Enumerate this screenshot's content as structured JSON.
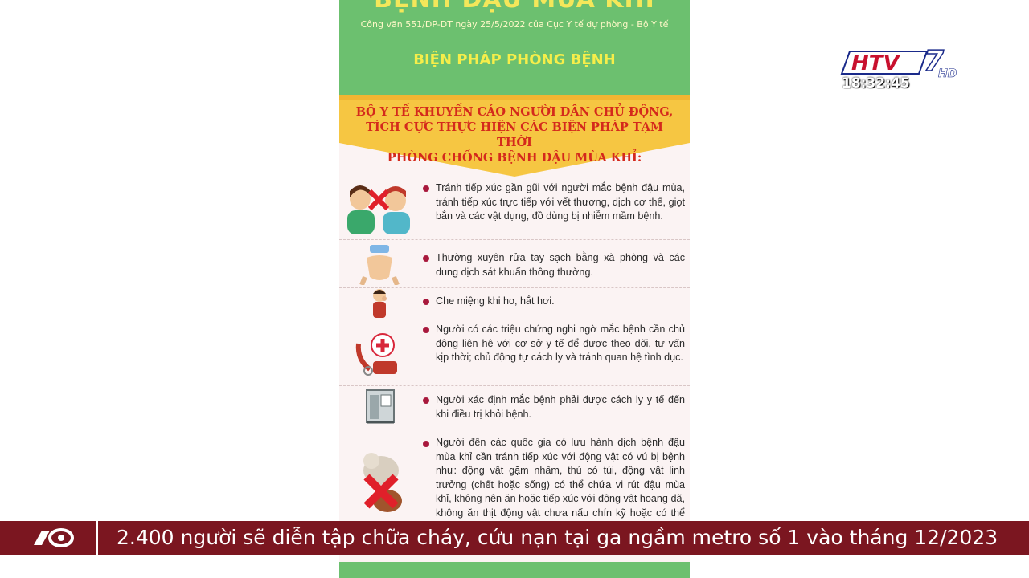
{
  "poster": {
    "title": "BỆNH ĐẬU MÙA KHỈ",
    "reference": "Công văn 551/DP-DT  ngày 25/5/2022 của Cục Y tế dự phòng - Bộ Y tế",
    "section_title": "BIỆN PHÁP PHÒNG BỆNH",
    "banner_lines": [
      "BỘ Y TẾ KHUYẾN CÁO NGƯỜI DÂN CHỦ ĐỘNG,",
      "TÍCH CỰC THỰC HIỆN CÁC BIỆN PHÁP TẠM THỜI",
      "PHÒNG CHỐNG BỆNH ĐẬU MÙA KHỈ:"
    ],
    "items": [
      {
        "icon": "avoid-contact-icon",
        "text": "Tránh tiếp xúc gần gũi với người mắc bệnh đậu mùa, tránh tiếp xúc trực tiếp với vết thương, dịch cơ thể, giọt bắn và các vật dụng, đồ dùng bị nhiễm mầm bệnh."
      },
      {
        "icon": "hand-washing-icon",
        "text": "Thường xuyên rửa tay sạch bằng xà phòng và các dung dịch sát khuẩn thông thường."
      },
      {
        "icon": "cough-cover-icon",
        "text": "Che miệng khi ho, hắt hơi."
      },
      {
        "icon": "medical-phone-icon",
        "text": "Người có các triệu chứng nghi ngờ mắc bệnh cần chủ động liên hệ với cơ sở y tế để được theo dõi, tư vấn kịp thời; chủ động tự cách ly và tránh quan hệ tình dục."
      },
      {
        "icon": "isolation-bed-icon",
        "text": "Người xác định mắc bệnh phải được cách ly y tế đến khi điều trị khỏi bệnh."
      },
      {
        "icon": "no-animal-contact-icon",
        "text": "Người đến các quốc gia có lưu hành dịch bệnh đậu mùa khỉ cần tránh tiếp xúc với động vật có vú bị bệnh như: động vật gặm nhấm, thú có túi, động vật linh trưởng (chết hoặc sống) có thể chứa vi rút đậu mùa khỉ, không nên ăn hoặc tiếp xúc với động vật hoang dã, không ăn thịt động vật chưa nấu chín kỹ hoặc có thể chứa vi rút gây bệnh từ động vật."
      }
    ]
  },
  "channel": {
    "logo_text": "HTV",
    "logo_number": "7",
    "logo_suffix": "HD",
    "clock": "18:32:45",
    "brand_color": "#c8102e"
  },
  "ticker": {
    "icon": "program-logo-icon",
    "headline": "2.400 người sẽ diễn tập chữa cháy, cứu nạn tại ga ngầm metro số 1 vào tháng 12/2023",
    "background": "#7b1620"
  }
}
